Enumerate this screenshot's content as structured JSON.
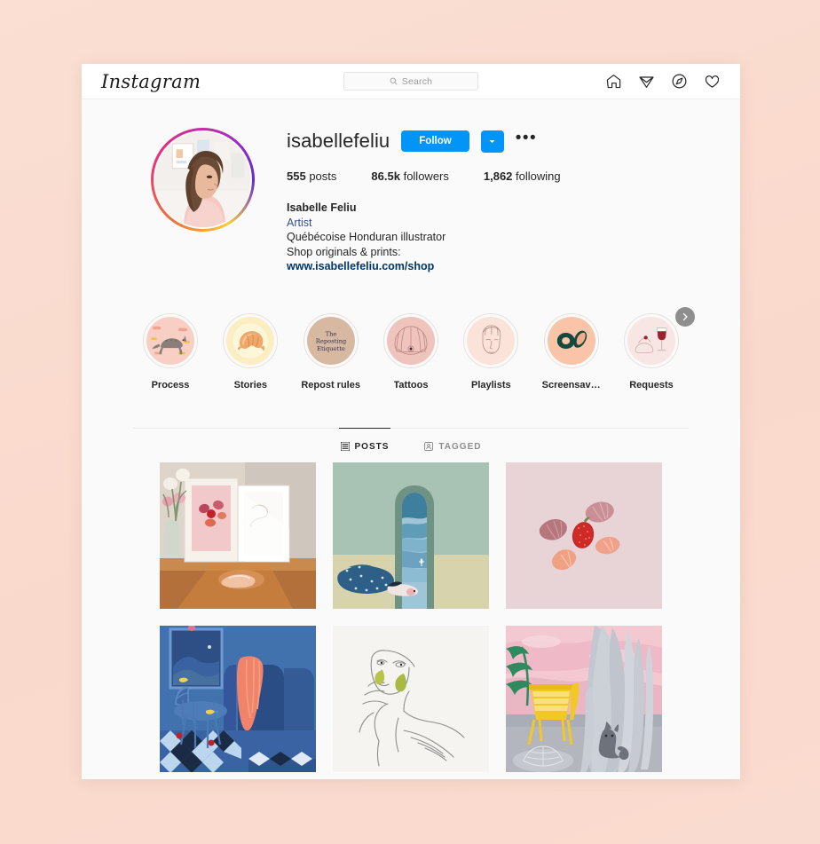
{
  "header": {
    "logo": "Instagram",
    "search_placeholder": "Search",
    "search_value": "",
    "nav": [
      {
        "name": "home-icon",
        "label": "Home"
      },
      {
        "name": "direct-paper-plane-icon",
        "label": "Direct"
      },
      {
        "name": "explore-compass-icon",
        "label": "Explore"
      },
      {
        "name": "activity-heart-icon",
        "label": "Activity"
      }
    ]
  },
  "profile": {
    "username": "isabellefeliu",
    "follow_label": "Follow",
    "options_label": "•••",
    "stats": [
      {
        "value": "555",
        "label": "posts"
      },
      {
        "value": "86.5k",
        "label": "followers"
      },
      {
        "value": "1,862",
        "label": "following"
      }
    ],
    "bio": {
      "full_name": "Isabelle Feliu",
      "category": "Artist",
      "line1": "Québécoise Honduran illustrator",
      "line2": "Shop originals & prints:",
      "link": "www.isabellefeliu.com/shop"
    }
  },
  "highlights": [
    {
      "label": "Process",
      "art": "cat"
    },
    {
      "label": "Stories",
      "art": "croissant"
    },
    {
      "label": "Repost rules",
      "art": "repost-text",
      "text": [
        "The",
        "Reposting",
        "Etiquette"
      ]
    },
    {
      "label": "Tattoos",
      "art": "shell"
    },
    {
      "label": "Playlists",
      "art": "face"
    },
    {
      "label": "Screensav…",
      "art": "abstract"
    },
    {
      "label": "Requests",
      "art": "wine"
    }
  ],
  "tabs": [
    {
      "label": "POSTS",
      "active": true,
      "icon": "grid-icon"
    },
    {
      "label": "TAGGED",
      "active": false,
      "icon": "tagged-person-icon"
    }
  ],
  "posts": [
    {
      "art": "desk-prints"
    },
    {
      "art": "arch-window"
    },
    {
      "art": "shells-pink"
    },
    {
      "art": "blue-interior"
    },
    {
      "art": "line-face"
    },
    {
      "art": "sunset-cat"
    }
  ],
  "colors": {
    "page_bg": "#fadcd0",
    "window_bg": "#fafafa",
    "accent_blue": "#0095f6",
    "link_blue": "#00376b",
    "category_blue": "#385185",
    "text": "#262626",
    "muted": "#8e8e8e"
  }
}
